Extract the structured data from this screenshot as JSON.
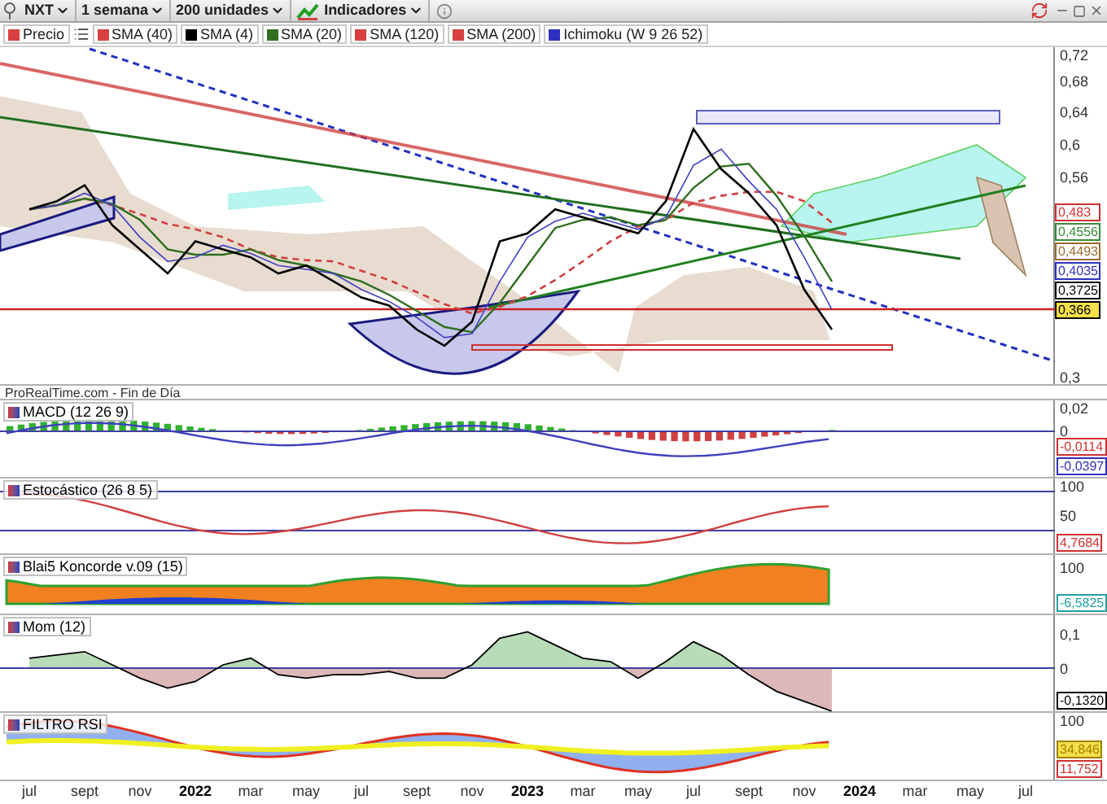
{
  "toolbar": {
    "symbol": "NXT",
    "interval": "1 semana",
    "units": "200 unidades",
    "indicators": "Indicadores"
  },
  "legend": [
    {
      "label": "Precio",
      "color": "#d94040"
    },
    {
      "label": "SMA (40)",
      "color": "#d94040"
    },
    {
      "label": "SMA (4)",
      "color": "#000000"
    },
    {
      "label": "SMA (20)",
      "color": "#2e6e1e"
    },
    {
      "label": "SMA (120)",
      "color": "#d94040"
    },
    {
      "label": "SMA (200)",
      "color": "#d94040"
    },
    {
      "label": "Ichimoku (W 9 26 52)",
      "color": "#3030c0"
    }
  ],
  "main_chart": {
    "axis_labels": [
      "0,72",
      "0,68",
      "0,64",
      "0,6",
      "0,56",
      "0,3"
    ],
    "tags": [
      {
        "text": "0,483",
        "color": "#d03030",
        "highlight": false
      },
      {
        "text": "0,4556",
        "color": "#3a8a3a",
        "highlight": false
      },
      {
        "text": "0,4493",
        "color": "#9a6a30",
        "highlight": false
      },
      {
        "text": "0,4035",
        "color": "#3030c0",
        "highlight": false
      },
      {
        "text": "0,3725",
        "color": "#000000",
        "highlight": false
      },
      {
        "text": "0,366",
        "color": "#000000",
        "highlight": true
      }
    ]
  },
  "source": "ProRealTime.com - Fin de Día",
  "indicators": [
    {
      "kind": "macd",
      "title": "MACD (12 26 9)",
      "axis_labels": [
        "0,02",
        "0"
      ],
      "tags": [
        {
          "text": "-0,0114",
          "color": "#d03030",
          "highlight": false
        },
        {
          "text": "-0,0397",
          "color": "#3030c0",
          "highlight": false
        }
      ]
    },
    {
      "kind": "stochastic",
      "title": "Estocástico (26 8 5)",
      "axis_labels": [
        "100",
        "50"
      ],
      "tags": [
        {
          "text": "4,7684",
          "color": "#d03030",
          "highlight": false
        }
      ]
    },
    {
      "kind": "koncorde",
      "title": "Blai5 Koncorde v.09 (15)",
      "axis_labels": [
        "100"
      ],
      "tags": [
        {
          "text": "-6,5825",
          "color": "#20a0a0",
          "highlight": false
        }
      ]
    },
    {
      "kind": "momentum",
      "title": "Mom (12)",
      "axis_labels": [
        "0,1",
        "0"
      ],
      "tags": [
        {
          "text": "-0,1320",
          "color": "#000000",
          "highlight": false
        }
      ]
    },
    {
      "kind": "rsi",
      "title": "FILTRO RSI",
      "axis_labels": [
        "100"
      ],
      "tags": [
        {
          "text": "34,846",
          "color": "#a08000",
          "highlight": true
        },
        {
          "text": "11,752",
          "color": "#d03030",
          "highlight": false
        }
      ]
    }
  ],
  "x_axis": [
    {
      "label": "jul",
      "year": false
    },
    {
      "label": "sept",
      "year": false
    },
    {
      "label": "nov",
      "year": false
    },
    {
      "label": "2022",
      "year": true
    },
    {
      "label": "mar",
      "year": false
    },
    {
      "label": "may",
      "year": false
    },
    {
      "label": "jul",
      "year": false
    },
    {
      "label": "sept",
      "year": false
    },
    {
      "label": "nov",
      "year": false
    },
    {
      "label": "2023",
      "year": true
    },
    {
      "label": "mar",
      "year": false
    },
    {
      "label": "may",
      "year": false
    },
    {
      "label": "jul",
      "year": false
    },
    {
      "label": "sept",
      "year": false
    },
    {
      "label": "nov",
      "year": false
    },
    {
      "label": "2024",
      "year": true
    },
    {
      "label": "mar",
      "year": false
    },
    {
      "label": "may",
      "year": false
    },
    {
      "label": "jul",
      "year": false
    }
  ]
}
